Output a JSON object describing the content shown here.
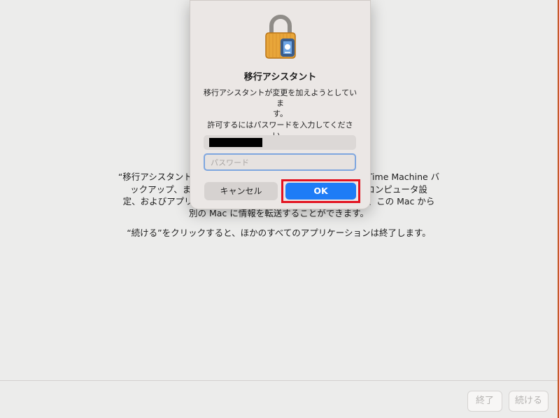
{
  "main": {
    "line1": "“移行アシスタント",
    "line1_right": "Time Machine バ",
    "line2": "ックアップ、ま",
    "line2_right": "コンピュータ設",
    "line3": "定、およびアプリ",
    "line3_right": "、この Mac から",
    "line4": "別の Mac に情報を転送することができます。",
    "line5": "“続ける”をクリックすると、ほかのすべてのアプリケーションは終了します。"
  },
  "footer": {
    "quit_label": "終了",
    "continue_label": "続ける"
  },
  "dialog": {
    "title": "移行アシスタント",
    "message_line1": "移行アシスタントが変更を加えようとしていま",
    "message_line2": "す。",
    "prompt": "許可するにはパスワードを入力してください。",
    "password_placeholder": "パスワード",
    "cancel_label": "キャンセル",
    "ok_label": "OK"
  },
  "colors": {
    "ok_accent": "#1e7cf6",
    "highlight": "#e3121f",
    "lock_gold": "#e8a63a"
  }
}
